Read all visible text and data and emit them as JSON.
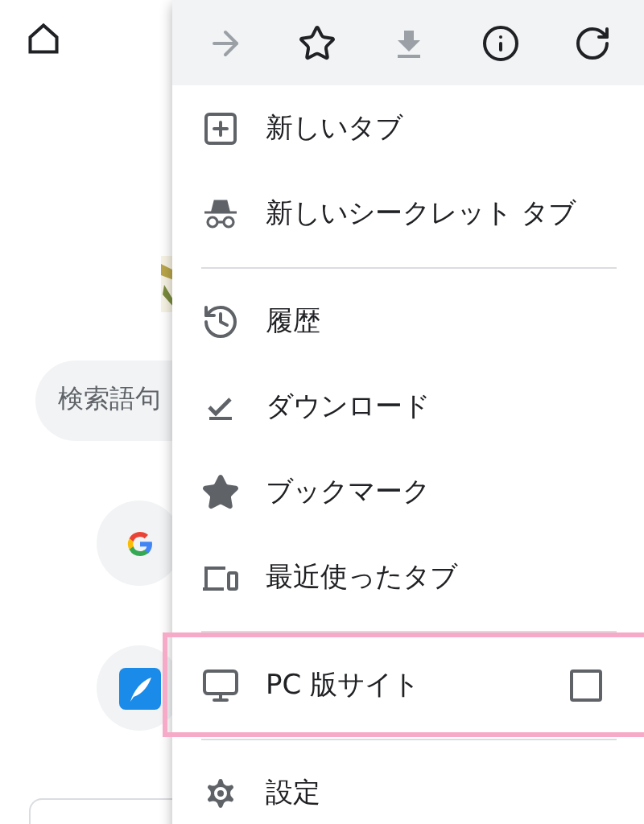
{
  "page": {
    "search": {
      "placeholder": "検索語句"
    }
  },
  "menu": {
    "toolbar": [
      {
        "disabled": true
      },
      {
        "disabled": false
      },
      {
        "disabled": true
      },
      {
        "disabled": false
      },
      {
        "disabled": false
      }
    ],
    "items": [
      {
        "kind": "item",
        "label": "新しいタブ"
      },
      {
        "kind": "item",
        "label": "新しいシークレット タブ"
      },
      {
        "kind": "divider"
      },
      {
        "kind": "item",
        "label": "履歴"
      },
      {
        "kind": "item",
        "label": "ダウンロード"
      },
      {
        "kind": "item",
        "label": "ブックマーク"
      },
      {
        "kind": "item",
        "label": "最近使ったタブ"
      },
      {
        "kind": "divider"
      },
      {
        "kind": "checkbox",
        "label": "PC 版サイト",
        "checked": false,
        "highlighted": true
      },
      {
        "kind": "divider"
      },
      {
        "kind": "item",
        "label": "設定"
      }
    ]
  }
}
